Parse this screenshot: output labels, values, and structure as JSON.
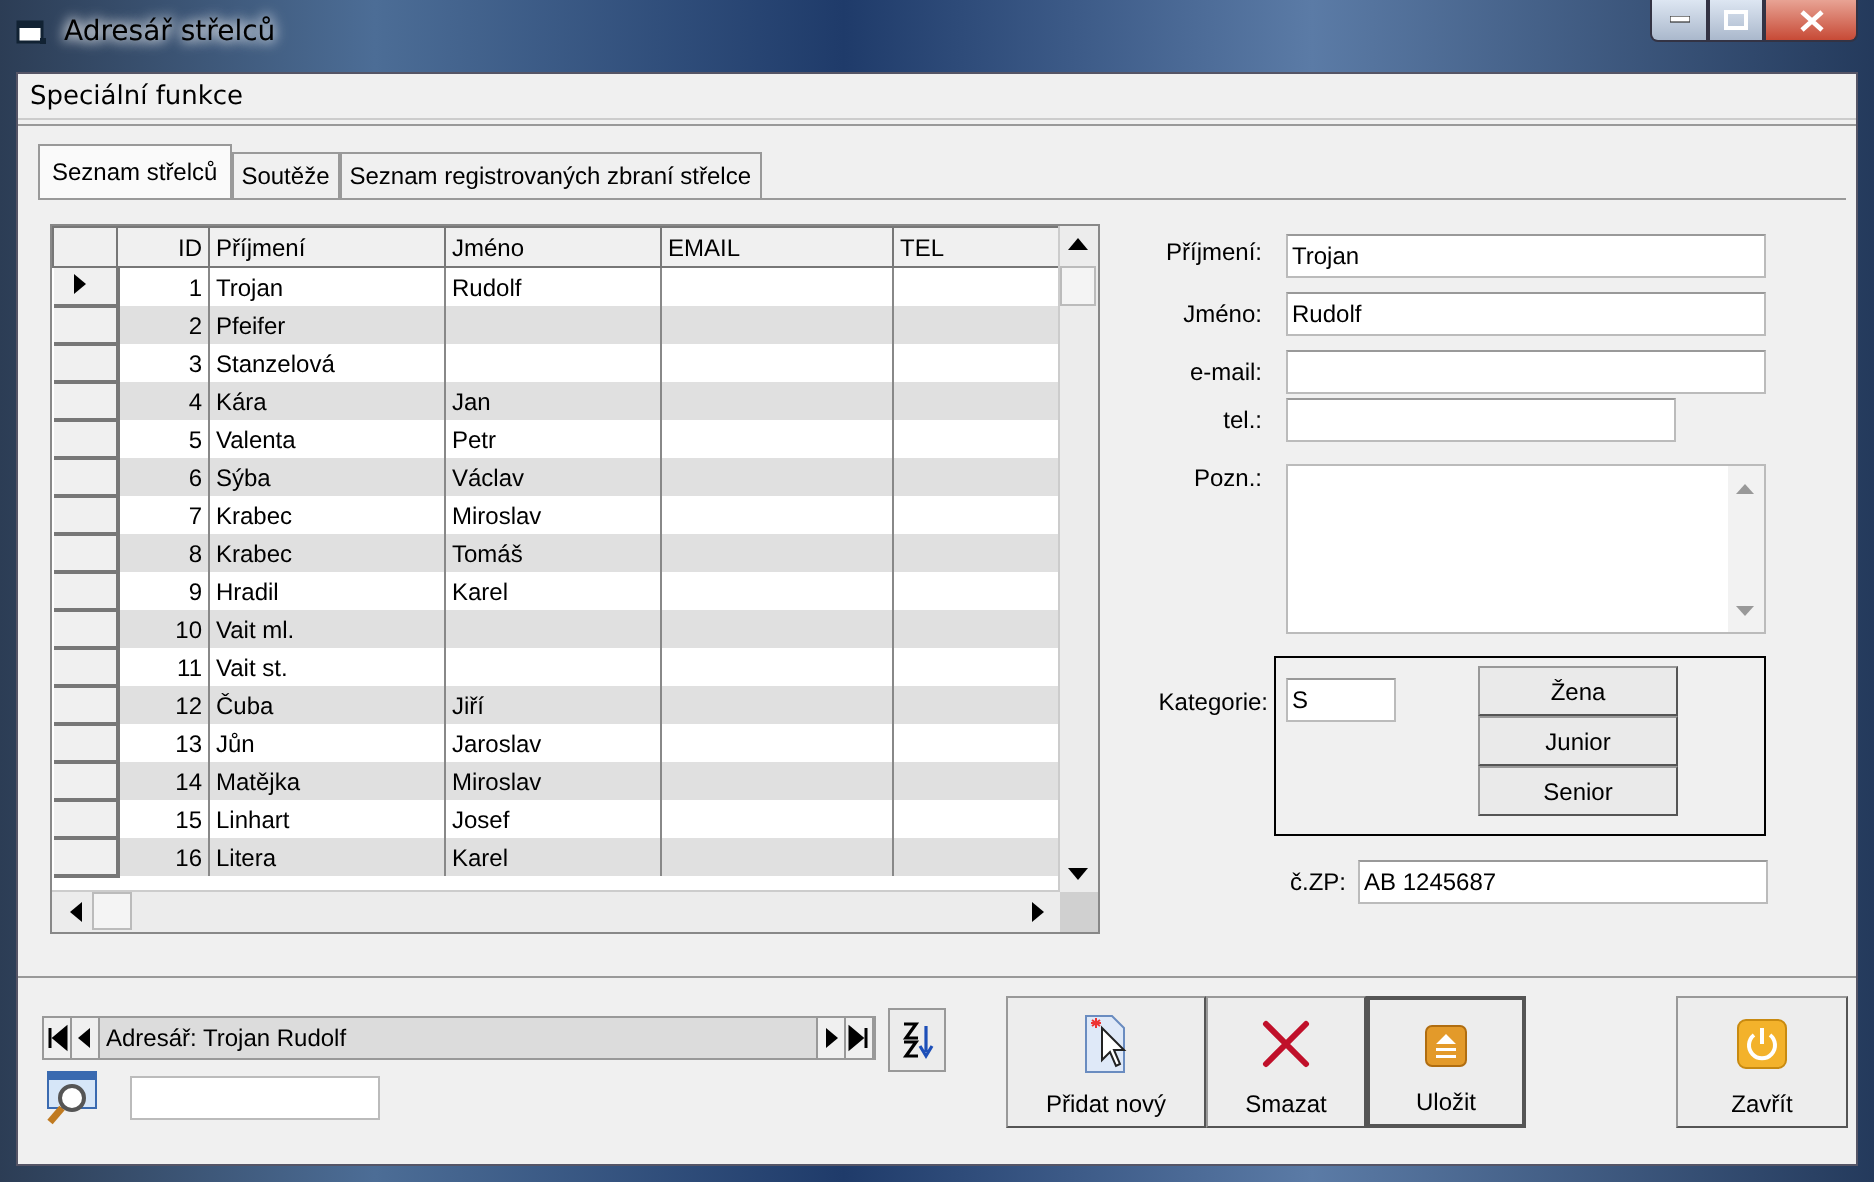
{
  "window": {
    "title": "Adresář střelců"
  },
  "menu": [
    {
      "label": "Speciální funkce"
    }
  ],
  "tabs": [
    {
      "label": "Seznam střelců",
      "selected": true
    },
    {
      "label": "Soutěže",
      "selected": false
    },
    {
      "label": "Seznam registrovaných zbraní střelce",
      "selected": false
    }
  ],
  "grid": {
    "columns": [
      "ID",
      "Příjmení",
      "Jméno",
      "EMAIL",
      "TEL"
    ],
    "rows": [
      {
        "id": "1",
        "surname": "Trojan",
        "name": "Rudolf",
        "selected": true
      },
      {
        "id": "2",
        "surname": "Pfeifer",
        "name": "",
        "selected": false
      },
      {
        "id": "3",
        "surname": "Stanzelová",
        "name": "",
        "selected": false
      },
      {
        "id": "4",
        "surname": "Kára",
        "name": "Jan",
        "selected": false
      },
      {
        "id": "5",
        "surname": "Valenta",
        "name": "Petr",
        "selected": false
      },
      {
        "id": "6",
        "surname": "Sýba",
        "name": "Václav",
        "selected": false
      },
      {
        "id": "7",
        "surname": "Krabec",
        "name": "Miroslav",
        "selected": false
      },
      {
        "id": "8",
        "surname": "Krabec",
        "name": "Tomáš",
        "selected": false
      },
      {
        "id": "9",
        "surname": "Hradil",
        "name": "Karel",
        "selected": false
      },
      {
        "id": "10",
        "surname": "Vait ml.",
        "name": "",
        "selected": false
      },
      {
        "id": "11",
        "surname": "Vait st.",
        "name": "",
        "selected": false
      },
      {
        "id": "12",
        "surname": "Čuba",
        "name": "Jiří",
        "selected": false
      },
      {
        "id": "13",
        "surname": "Jůn",
        "name": "Jaroslav",
        "selected": false
      },
      {
        "id": "14",
        "surname": "Matějka",
        "name": "Miroslav",
        "selected": false
      },
      {
        "id": "15",
        "surname": "Linhart",
        "name": "Josef",
        "selected": false
      },
      {
        "id": "16",
        "surname": "Litera",
        "name": "Karel",
        "selected": false
      }
    ]
  },
  "form": {
    "fields": [
      {
        "label": "Příjmení:",
        "value": "Trojan"
      },
      {
        "label": "Jméno:",
        "value": "Rudolf"
      },
      {
        "label": "e-mail:"
      },
      {
        "label": "tel.:"
      }
    ],
    "notes": {
      "label": "Pozn.:"
    },
    "category": {
      "label": "Kategorie:",
      "value": "S",
      "buttons": [
        "Žena",
        "Junior",
        "Senior"
      ]
    },
    "permit": {
      "label": "č.ZP:",
      "value": "AB 1245687"
    }
  },
  "navigator": {
    "caption": "Adresář: Trojan Rudolf"
  },
  "buttons": [
    {
      "label": "Přidat nový",
      "kind": "new"
    },
    {
      "label": "Smazat",
      "kind": "delete"
    },
    {
      "label": "Uložit",
      "kind": "save"
    },
    {
      "label": "Zavřít",
      "kind": "close"
    }
  ]
}
